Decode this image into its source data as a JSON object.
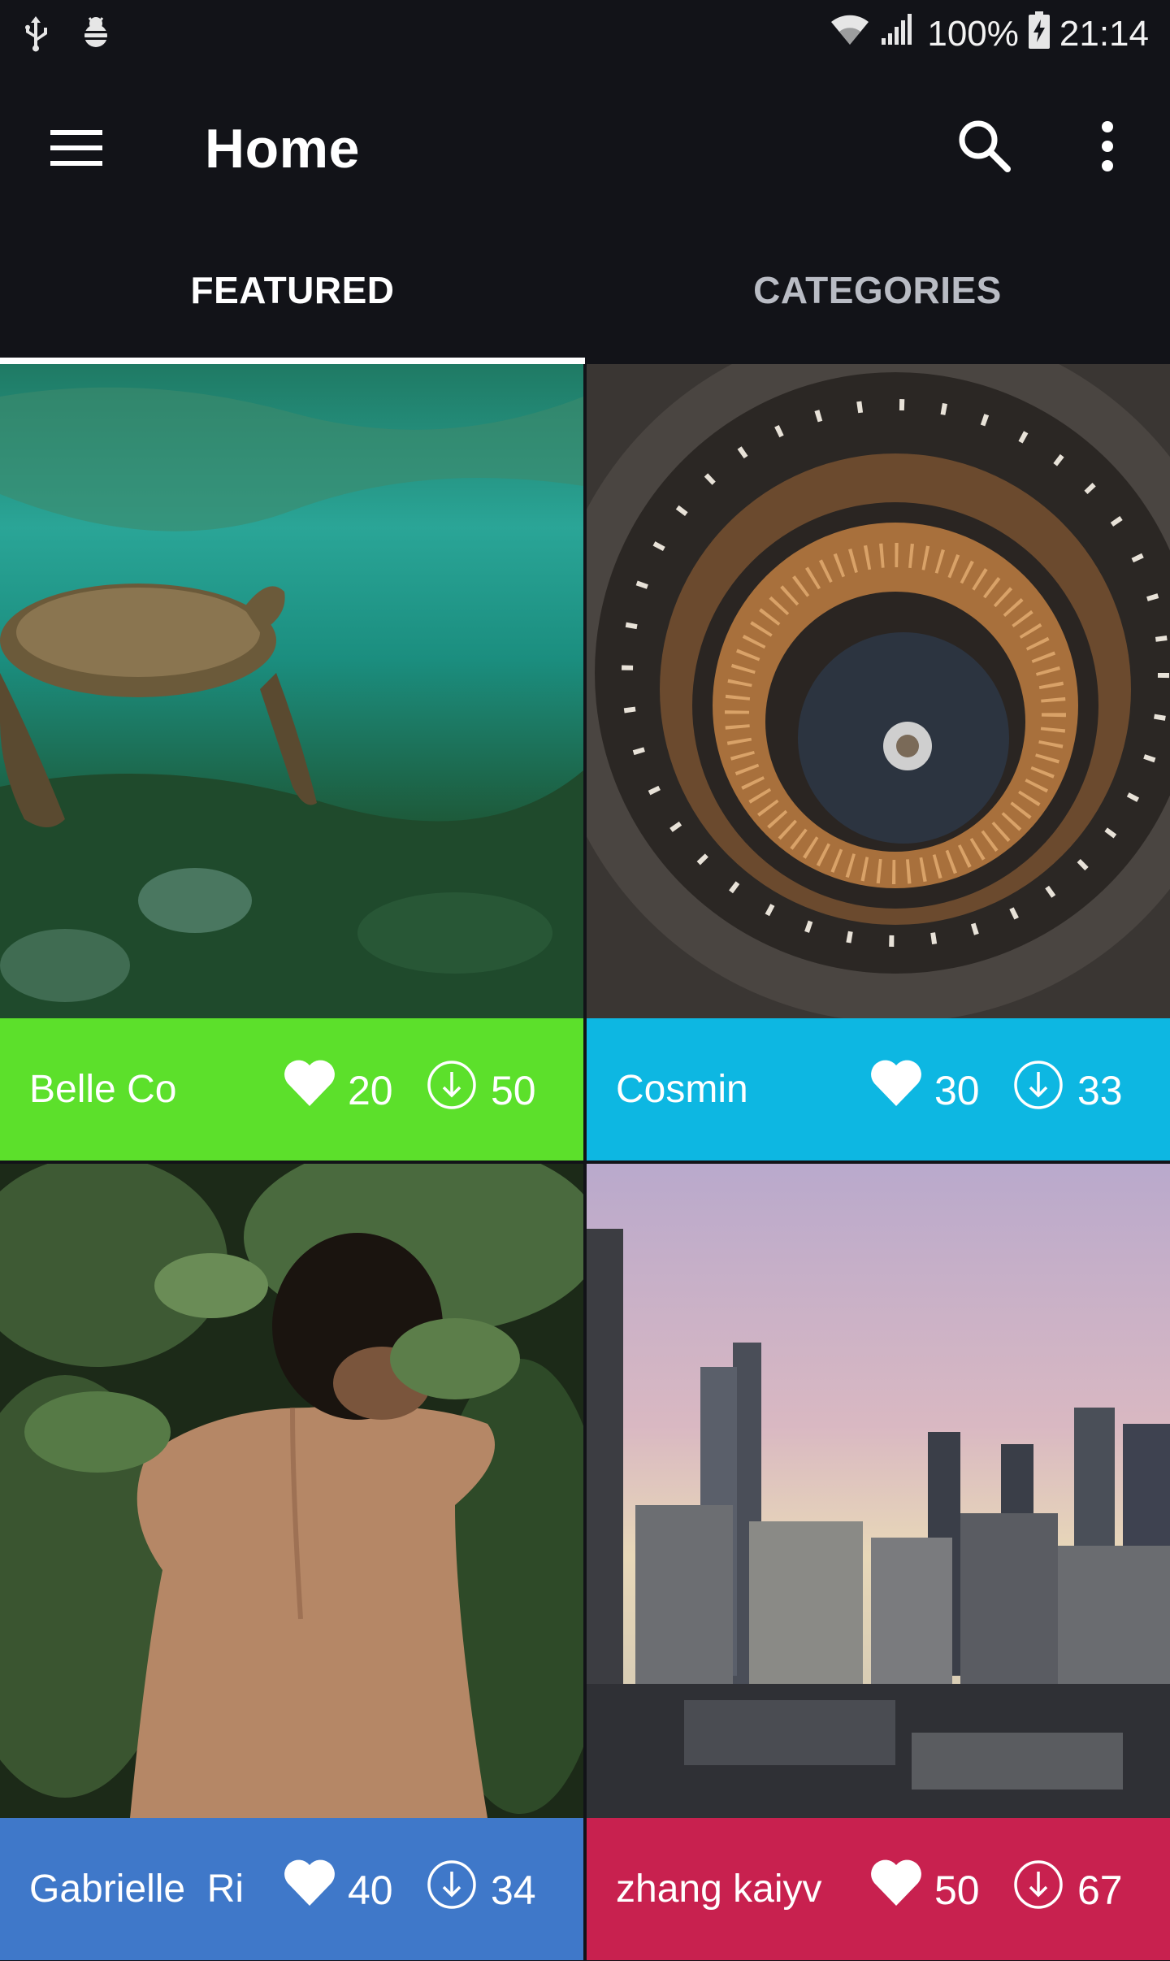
{
  "status_bar": {
    "battery": "100%",
    "time": "21:14",
    "icons": [
      "usb-icon",
      "debug-icon",
      "wifi-icon",
      "signal-icon",
      "battery-charging-icon"
    ]
  },
  "app_bar": {
    "title": "Home",
    "icons": [
      "menu-icon",
      "search-icon",
      "more-vert-icon"
    ]
  },
  "tabs": [
    {
      "label": "FEATURED",
      "selected": true
    },
    {
      "label": "CATEGORIES",
      "selected": false
    }
  ],
  "cards": [
    {
      "author": "Belle Co",
      "likes": "20",
      "downloads": "50",
      "color": "#5ce02b"
    },
    {
      "author": "Cosmin",
      "likes": "30",
      "downloads": "33",
      "color": "#0db7e2"
    },
    {
      "author": "Gabrielle  Ri",
      "likes": "40",
      "downloads": "34",
      "color": "#3f78c9"
    },
    {
      "author": "zhang kaiyv",
      "likes": "50",
      "downloads": "67",
      "color": "#c8214f"
    }
  ],
  "colors": {
    "background": "#121318",
    "tab_indicator": "#ffffff",
    "tab_inactive": "#b9bcc4"
  }
}
